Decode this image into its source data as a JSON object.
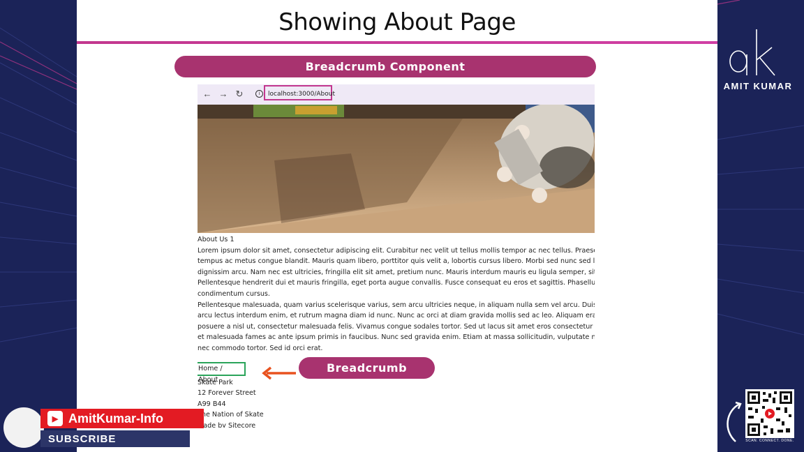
{
  "slide": {
    "title": "Showing About Page",
    "component_label": "Breadcrumb Component",
    "callout_label": "Breadcrumb"
  },
  "browser": {
    "url": "localhost:3000/About",
    "back_icon": "arrow-left-icon",
    "forward_icon": "arrow-right-icon",
    "reload_icon": "reload-icon",
    "info_icon": "info-icon"
  },
  "page": {
    "heading": "About Us 1",
    "paragraph1": [
      "Lorem ipsum dolor sit amet, consectetur adipiscing elit. Curabitur nec velit ut tellus mollis tempor ac nec tellus. Praesent mol",
      "tempus ac metus congue blandit. Mauris quam libero, porttitor quis velit a, lobortis cursus libero. Morbi sed nunc sed lectus",
      "dignissim arcu. Nam nec est ultricies, fringilla elit sit amet, pretium nunc. Mauris interdum mauris eu ligula semper, sit amet p",
      "Pellentesque hendrerit dui et mauris fringilla, eget porta augue convallis. Fusce consequat eu eros et sagittis. Phasellus sit am",
      "condimentum cursus."
    ],
    "paragraph2": [
      "Pellentesque malesuada, quam varius scelerisque varius, sem arcu ultricies neque, in aliquam nulla sem vel arcu. Duis blandit,",
      "arcu lectus interdum enim, et rutrum magna diam id nunc. Nunc ac orci at diam gravida mollis sed ac leo. Aliquam erat volut",
      "posuere a nisl ut, consectetur malesuada felis. Vivamus congue sodales tortor. Sed ut lacus sit amet eros consectetur laoreet",
      "et malesuada fames ac ante ipsum primis in faucibus. Nunc sed gravida enim. Etiam at massa sollicitudin, vulputate nisi quis,",
      "nec commodo tortor. Sed id orci erat."
    ],
    "breadcrumb": "Home / About",
    "footer": [
      "Skate Park",
      "12 Forever Street",
      "A99 B44",
      "The Nation of Skate",
      "Made by Sitecore"
    ]
  },
  "brand": {
    "name": "AMIT KUMAR",
    "qr_caption": "SCAN. CONNECT. DONE."
  },
  "badge": {
    "youtube_icon_text": "You Tube",
    "channel": "AmitKumar-Info",
    "subscribe": "SUBSCRIBE"
  },
  "colors": {
    "accent": "#a8336f",
    "highlight_url": "#c2378e",
    "highlight_crumb": "#2aa45a",
    "arrow": "#e8521f",
    "background": "#1b2358"
  }
}
